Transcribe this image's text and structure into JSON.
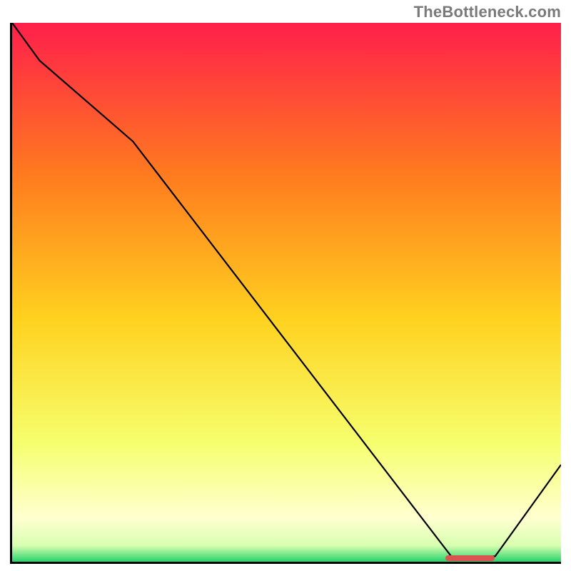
{
  "watermark": "TheBottleneck.com",
  "colors": {
    "gradient_top": "#ff1f4b",
    "gradient_upper_mid": "#ff7a1f",
    "gradient_mid": "#ffd21f",
    "gradient_lower_mid": "#f6ff6e",
    "gradient_near_bottom": "#d8ffb0",
    "gradient_bottom": "#27d36b",
    "curve": "#000000",
    "marker": "#d9544f",
    "axis": "#000000"
  },
  "chart_data": {
    "type": "line",
    "title": "",
    "xlabel": "",
    "ylabel": "",
    "xlim": [
      0,
      100
    ],
    "ylim": [
      0,
      100
    ],
    "categories": [
      0,
      5,
      22,
      80,
      88,
      100
    ],
    "series": [
      {
        "name": "curve",
        "values": [
          100,
          93,
          78,
          1,
          1,
          18
        ]
      }
    ],
    "marker": {
      "x_start": 79,
      "x_end": 88,
      "y": 1
    },
    "gradient_stops": [
      {
        "pct": 0,
        "color": "#ff1f4b"
      },
      {
        "pct": 28,
        "color": "#ff7a1f"
      },
      {
        "pct": 55,
        "color": "#ffd21f"
      },
      {
        "pct": 78,
        "color": "#f6ff6e"
      },
      {
        "pct": 92,
        "color": "#ffffd0"
      },
      {
        "pct": 97,
        "color": "#d8ffb0"
      },
      {
        "pct": 100,
        "color": "#27d36b"
      }
    ]
  }
}
